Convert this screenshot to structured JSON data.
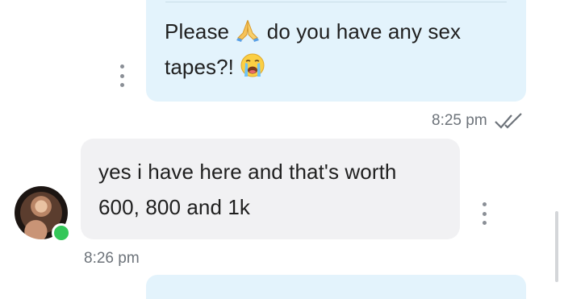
{
  "messages": [
    {
      "direction": "outgoing",
      "text_before_emoji": "Please",
      "emoji1": "folded-hands",
      "text_mid": "do you have any sex",
      "text_line2": "tapes?!",
      "emoji2": "loudly-crying-face",
      "time": "8:25 pm",
      "status": "read"
    },
    {
      "direction": "incoming",
      "line1": "yes i have here and that's worth",
      "line2": "600, 800 and 1k",
      "time": "8:26 pm"
    }
  ],
  "colors": {
    "outgoing_bubble": "#e3f3fc",
    "incoming_bubble": "#f1f1f3",
    "online": "#34c759",
    "timestamp": "#6d737a"
  }
}
